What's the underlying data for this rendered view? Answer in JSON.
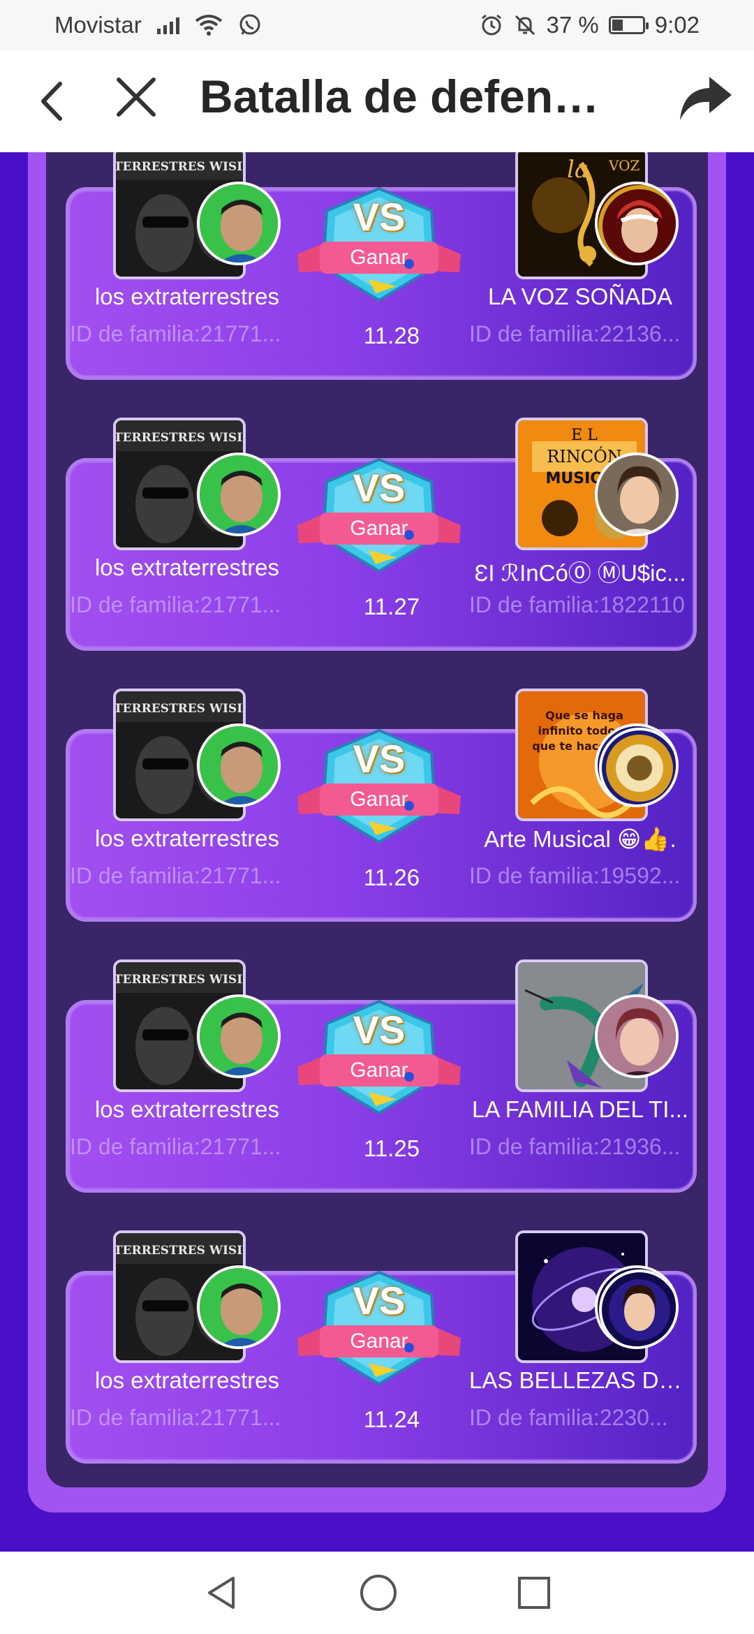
{
  "status_bar": {
    "carrier": "Movistar",
    "battery_percent": "37 %",
    "time": "9:02",
    "icons": [
      "signal-icon",
      "wifi-icon",
      "whatsapp-icon",
      "alarm-icon",
      "mute-icon",
      "battery-icon"
    ]
  },
  "header": {
    "title": "Batalla de defen…",
    "back_icon": "chevron-left-icon",
    "close_icon": "close-icon",
    "share_icon": "share-icon"
  },
  "battles": [
    {
      "left_name": "los extraterrestres",
      "left_id": "ID de familia:21771...",
      "right_name": "LA VOZ SOÑADA",
      "right_id": "ID de familia:22136...",
      "vs": "VS",
      "result": "Ganar",
      "date": "11.28",
      "right_photo_text": "la voz SOÑADA"
    },
    {
      "left_name": "los extraterrestres",
      "left_id": "ID de familia:21771...",
      "right_name": "ƐI ℛInCó⓪ ⓂU$ic...",
      "right_id": "ID de familia:1822110",
      "vs": "VS",
      "result": "Ganar",
      "date": "11.27",
      "right_photo_text": "EL RINCÓN MUSICAL"
    },
    {
      "left_name": "los extraterrestres",
      "left_id": "ID de familia:21771...",
      "right_name": "Arte Musical 😁👍.",
      "right_id": "ID de familia:19592...",
      "vs": "VS",
      "result": "Ganar",
      "date": "11.26",
      "right_photo_text": "Que se haga infinito todo lo que te hace feliz"
    },
    {
      "left_name": "los extraterrestres",
      "left_id": "ID de familia:21771...",
      "right_name": "LA FAMILIA DEL TI...",
      "right_id": "ID de familia:21936...",
      "vs": "VS",
      "result": "Ganar",
      "date": "11.25",
      "right_photo_text": ""
    },
    {
      "left_name": "los extraterrestres",
      "left_id": "ID de familia:21771...",
      "right_name": "LAS BELLEZAS DE...",
      "right_id": "ID de familia:2230...",
      "vs": "VS",
      "result": "Ganar",
      "date": "11.24",
      "right_photo_text": ""
    }
  ],
  "left_photo_text": "LOS EXTRATERRESTRES WISIN & YANDEL",
  "nav": {
    "back": "back-triangle-icon",
    "home": "home-circle-icon",
    "recents": "recents-square-icon"
  },
  "colors": {
    "page_bg": "#4a10c8",
    "panel": "#a154ef",
    "panel_inner": "#3a2568",
    "card_border": "#b07cf0"
  }
}
